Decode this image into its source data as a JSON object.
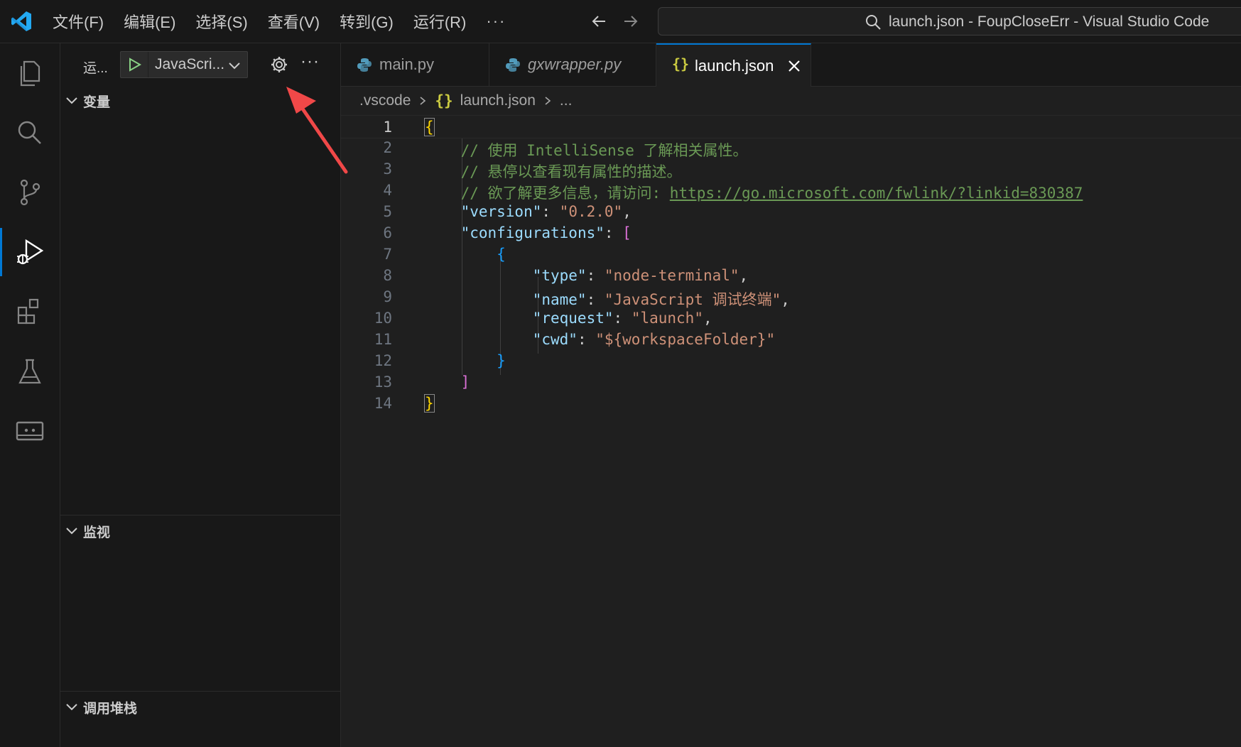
{
  "window": {
    "title": "launch.json - FoupCloseErr - Visual Studio Code"
  },
  "menu": {
    "items": [
      "文件(F)",
      "编辑(E)",
      "选择(S)",
      "查看(V)",
      "转到(G)",
      "运行(R)"
    ],
    "more": "···"
  },
  "sidebar": {
    "title": "运...",
    "run_config": "JavaScri...",
    "more": "···",
    "sections": [
      "变量",
      "监视",
      "调用堆栈"
    ]
  },
  "tabs": [
    {
      "label": "main.py",
      "icon": "python-icon"
    },
    {
      "label": "gxwrapper.py",
      "icon": "python-icon"
    },
    {
      "label": "launch.json",
      "icon": "json-icon"
    }
  ],
  "breadcrumb": {
    "folder": ".vscode",
    "file_icon": "{}",
    "file": "launch.json",
    "more": "..."
  },
  "editor": {
    "line_numbers": [
      "1",
      "2",
      "3",
      "4",
      "5",
      "6",
      "7",
      "8",
      "9",
      "10",
      "11",
      "12",
      "13",
      "14"
    ],
    "code": {
      "l1_open": "{",
      "l2_comment": "// 使用 IntelliSense 了解相关属性。",
      "l3_comment": "// 悬停以查看现有属性的描述。",
      "l4_comment": "// 欲了解更多信息，请访问: ",
      "l4_link": "https://go.microsoft.com/fwlink/?linkid=830387",
      "version_key": "\"version\"",
      "version_val": "\"0.2.0\"",
      "configs_key": "\"configurations\"",
      "bracket_open": "[",
      "obj_open": "{",
      "type_key": "\"type\"",
      "type_val": "\"node-terminal\"",
      "name_key": "\"name\"",
      "name_val": "\"JavaScript 调试终端\"",
      "request_key": "\"request\"",
      "request_val": "\"launch\"",
      "cwd_key": "\"cwd\"",
      "cwd_val": "\"${workspaceFolder}\"",
      "obj_close": "}",
      "bracket_close": "]",
      "l14_close": "}"
    }
  },
  "colors": {
    "accent": "#0078d4",
    "annotation_arrow": "#f04848"
  }
}
